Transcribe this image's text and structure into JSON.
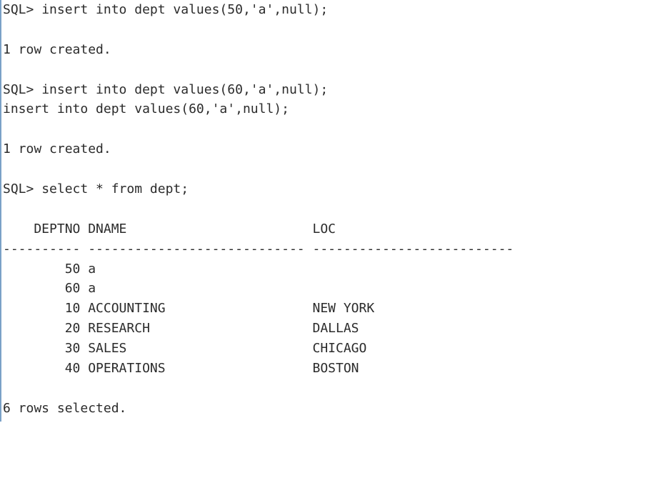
{
  "lines": [
    {
      "prompt": "SQL> ",
      "text": "insert into dept values(50,'a',null);"
    },
    {
      "text": " "
    },
    {
      "text": "1 row created."
    },
    {
      "text": " "
    },
    {
      "prompt": "SQL> ",
      "text": "insert into dept values(60,'a',null);"
    },
    {
      "text": "insert into dept values(60,'a',null);"
    },
    {
      "text": " "
    },
    {
      "text": "1 row created."
    },
    {
      "text": " "
    },
    {
      "prompt": "SQL> ",
      "text": "select * from dept;"
    },
    {
      "text": " "
    },
    {
      "text": "    DEPTNO DNAME                        LOC"
    },
    {
      "text": "---------- ---------------------------- --------------------------"
    },
    {
      "text": "        50 a"
    },
    {
      "text": "        60 a"
    },
    {
      "text": "        10 ACCOUNTING                   NEW YORK"
    },
    {
      "text": "        20 RESEARCH                     DALLAS"
    },
    {
      "text": "        30 SALES                        CHICAGO"
    },
    {
      "text": "        40 OPERATIONS                   BOSTON"
    },
    {
      "text": " "
    },
    {
      "text": "6 rows selected."
    }
  ],
  "query_result": {
    "columns": [
      "DEPTNO",
      "DNAME",
      "LOC"
    ],
    "rows": [
      {
        "DEPTNO": 50,
        "DNAME": "a",
        "LOC": null
      },
      {
        "DEPTNO": 60,
        "DNAME": "a",
        "LOC": null
      },
      {
        "DEPTNO": 10,
        "DNAME": "ACCOUNTING",
        "LOC": "NEW YORK"
      },
      {
        "DEPTNO": 20,
        "DNAME": "RESEARCH",
        "LOC": "DALLAS"
      },
      {
        "DEPTNO": 30,
        "DNAME": "SALES",
        "LOC": "CHICAGO"
      },
      {
        "DEPTNO": 40,
        "DNAME": "OPERATIONS",
        "LOC": "BOSTON"
      }
    ],
    "rows_selected": 6
  }
}
